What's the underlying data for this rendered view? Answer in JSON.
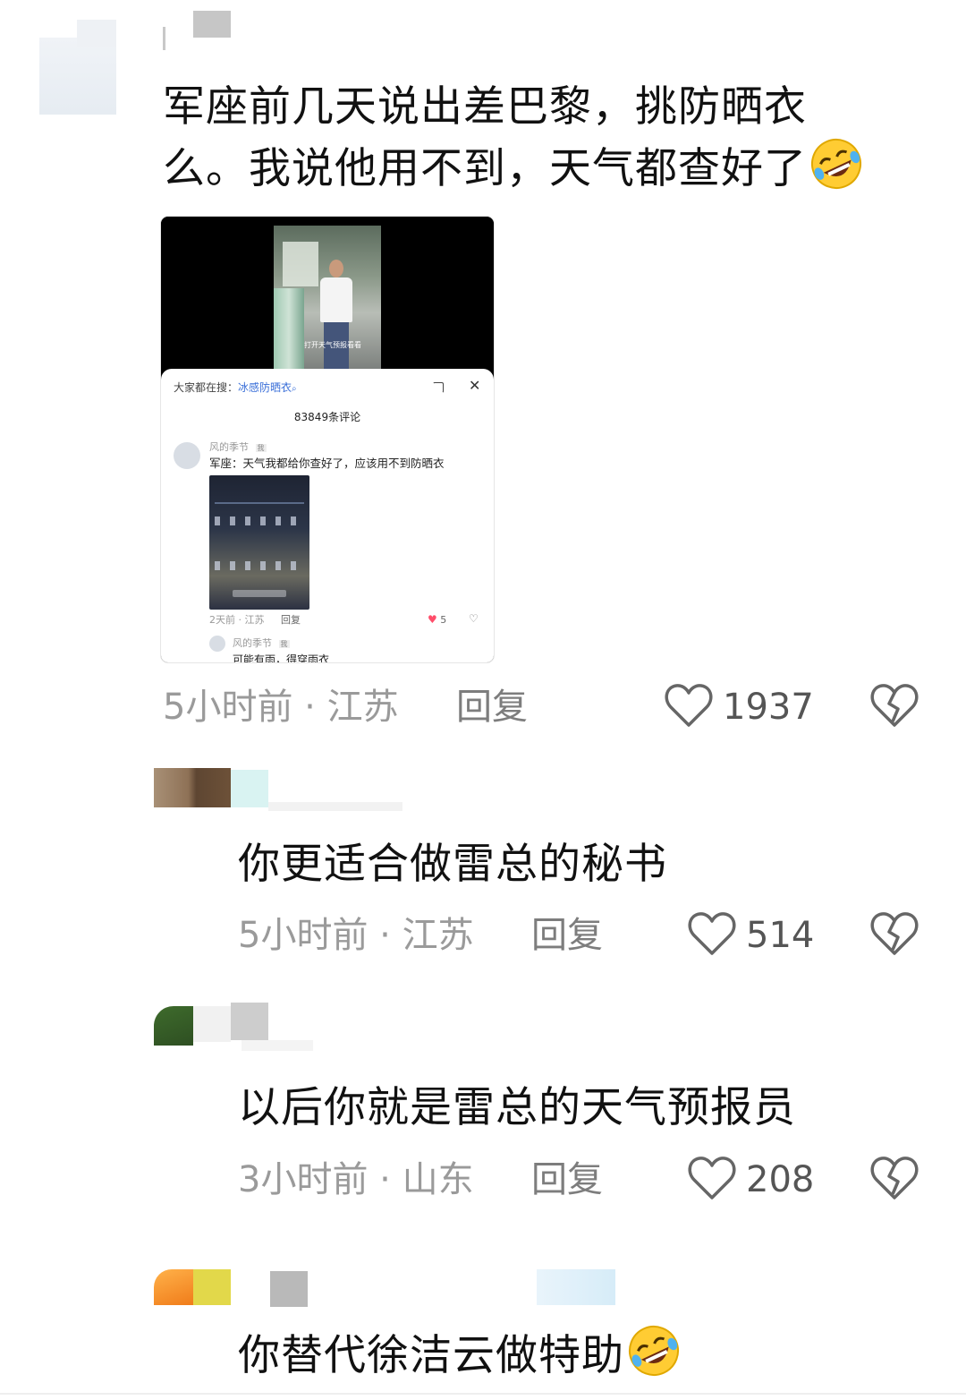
{
  "comments": [
    {
      "text_line1": "军座前几天说出差巴黎，挑防晒衣",
      "text_line2": "么。我说他用不到，天气都查好了",
      "time_location": "5小时前 · 江苏",
      "reply_label": "回复",
      "likes": "1937",
      "emoji": "rofl-emoji"
    },
    {
      "text": "你更适合做雷总的秘书",
      "time_location": "5小时前 · 江苏",
      "reply_label": "回复",
      "likes": "514"
    },
    {
      "text": "以后你就是雷总的天气预报员",
      "time_location": "3小时前 · 山东",
      "reply_label": "回复",
      "likes": "208"
    },
    {
      "text": "你替代徐洁云做特助",
      "emoji": "rofl-emoji"
    }
  ],
  "embedded_screenshot": {
    "caption_subtitle": "打开天气预报看看",
    "search_prefix": "大家都在搜：",
    "search_term": "冰感防晒衣",
    "comment_count": "83849条评论",
    "inner_comment": {
      "username": "风的季节",
      "author_tag": "我",
      "text": "军座：天气我都给你查好了，应该用不到防晒衣",
      "time_location": "2天前 · 江苏",
      "reply_label": "回复",
      "likes": "5"
    },
    "inner_reply": {
      "username": "风的季节",
      "author_tag": "我",
      "text": "可能有雨，得穿雨衣"
    }
  },
  "colors": {
    "meta_gray": "#9a9a9a",
    "heart_outline": "#666666",
    "link_blue": "#3a6fd8",
    "like_red": "#ff4d6a"
  }
}
